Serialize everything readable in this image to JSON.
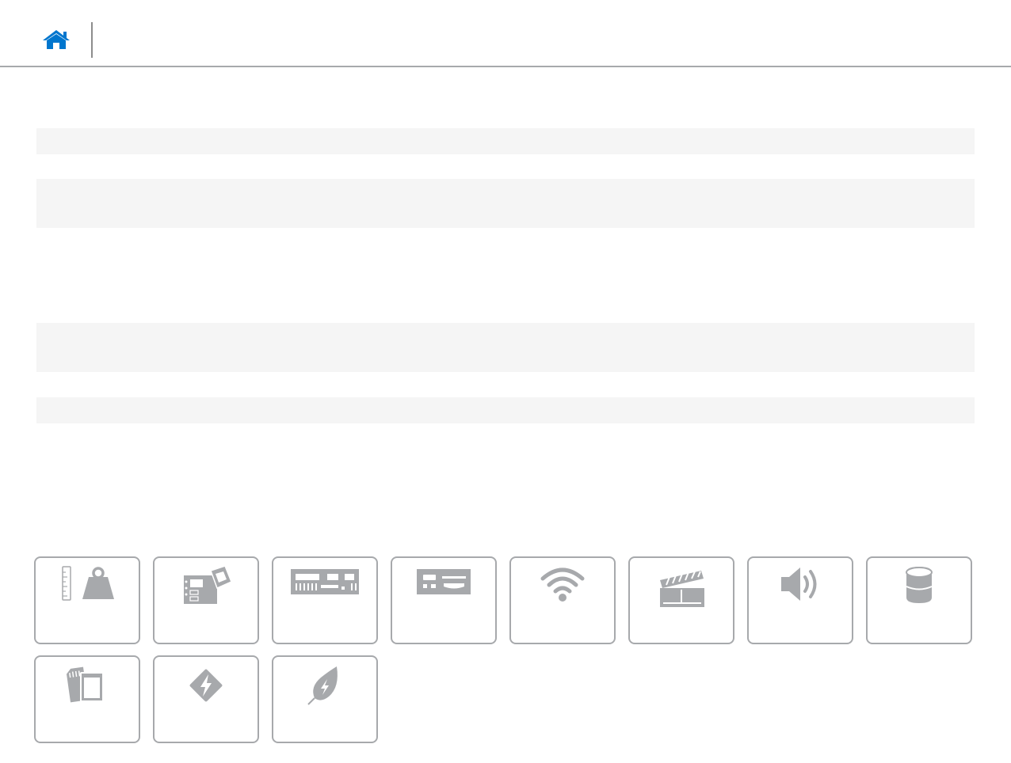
{
  "header": {
    "home_icon": "home-icon",
    "accent_color": "#0076ce"
  },
  "tiles": [
    {
      "name": "dimensions-weight",
      "icon": "weight-ruler-icon"
    },
    {
      "name": "system-board",
      "icon": "motherboard-icon"
    },
    {
      "name": "memory",
      "icon": "memory-module-icon"
    },
    {
      "name": "ports-connectors",
      "icon": "ports-icon"
    },
    {
      "name": "communications",
      "icon": "wifi-icon"
    },
    {
      "name": "video",
      "icon": "clapperboard-icon"
    },
    {
      "name": "audio",
      "icon": "speaker-icon"
    },
    {
      "name": "storage",
      "icon": "storage-drive-icon"
    },
    {
      "name": "media-card-reader",
      "icon": "memory-card-icon"
    },
    {
      "name": "power-adapter",
      "icon": "power-adapter-icon"
    },
    {
      "name": "environmental",
      "icon": "leaf-icon"
    }
  ],
  "colors": {
    "icon_gray": "#a7a9ac",
    "stripe": "#f5f5f5",
    "border": "#a7a9ac"
  }
}
